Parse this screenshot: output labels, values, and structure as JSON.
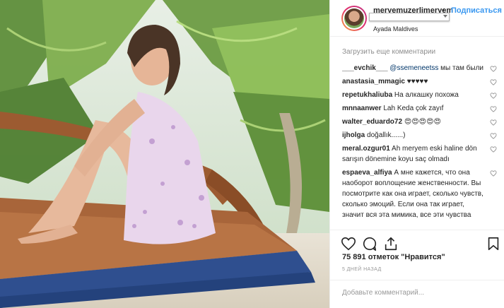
{
  "header": {
    "username": "meryemuzerlimeryem",
    "dot": "•",
    "follow_label": "Подписаться",
    "location": "Ayada Maldives"
  },
  "comments": {
    "load_more": "Загрузить еще комментарии",
    "items": [
      {
        "user": "___evchik___",
        "mention": "@ssemeneetss",
        "text": " мы там были"
      },
      {
        "user": "anastasia_mmagic",
        "mention": "",
        "text": " ♥♥♥♥♥"
      },
      {
        "user": "repetukhaliuba",
        "mention": "",
        "text": " На алкашку похожа"
      },
      {
        "user": "mnnaanwer",
        "mention": "",
        "text": " Lah Keda çok zayıf"
      },
      {
        "user": "walter_eduardo72",
        "mention": "",
        "text": " 😍😍😍😍😍"
      },
      {
        "user": "ijholga",
        "mention": "",
        "text": " doğallık......)"
      },
      {
        "user": "meral.ozgur01",
        "mention": "",
        "text": " Ah meryem eski haline dön sarışın dönemine koyu saç olmadı"
      },
      {
        "user": "espaeva_alfiya",
        "mention": "",
        "text": " А мне кажется, что она наоборот воплощение женственности. Вы посмотрите как она играет, сколько чувств, сколько эмоций. Если она так играет, значит вся эта мимика, все эти чувства"
      }
    ]
  },
  "likes_text": "75 891 отметок \"Нравится\"",
  "time_text": "5 ДНЕЙ НАЗАД",
  "add_comment_placeholder": "Добавьте комментарий...",
  "icons": {
    "like": "heart-icon",
    "comment": "comment-icon",
    "share": "share-icon",
    "save": "bookmark-icon"
  },
  "colors": {
    "link": "#3897f0",
    "mention": "#003569",
    "muted": "#8e8e8e"
  }
}
